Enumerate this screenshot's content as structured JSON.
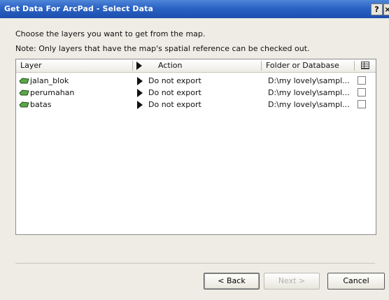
{
  "window": {
    "title": "Get Data For ArcPad - Select Data",
    "help_label": "?",
    "close_label": "×"
  },
  "instructions": {
    "line1": "Choose the layers you want to get from the map.",
    "line2": "Note: Only layers that have the map's spatial reference can be checked out."
  },
  "table": {
    "columns": {
      "layer": "Layer",
      "action": "Action",
      "folder": "Folder or Database"
    },
    "rows": [
      {
        "layer": "jalan_blok",
        "action": "Do not export",
        "folder": "D:\\my lovely\\sampl...",
        "checked": false
      },
      {
        "layer": "perumahan",
        "action": "Do not export",
        "folder": "D:\\my lovely\\sampl...",
        "checked": false
      },
      {
        "layer": "batas",
        "action": "Do not export",
        "folder": "D:\\my lovely\\sampl...",
        "checked": false
      }
    ]
  },
  "buttons": {
    "back": "< Back",
    "next": "Next >",
    "cancel": "Cancel"
  },
  "colors": {
    "title_bar": "#2a62c4",
    "dialog_bg": "#eeece4",
    "disabled_text": "#b2b0a8"
  },
  "icons": {
    "layer": "polygon-layer-icon",
    "action": "play-triangle-icon",
    "select_all": "grid-icon"
  }
}
